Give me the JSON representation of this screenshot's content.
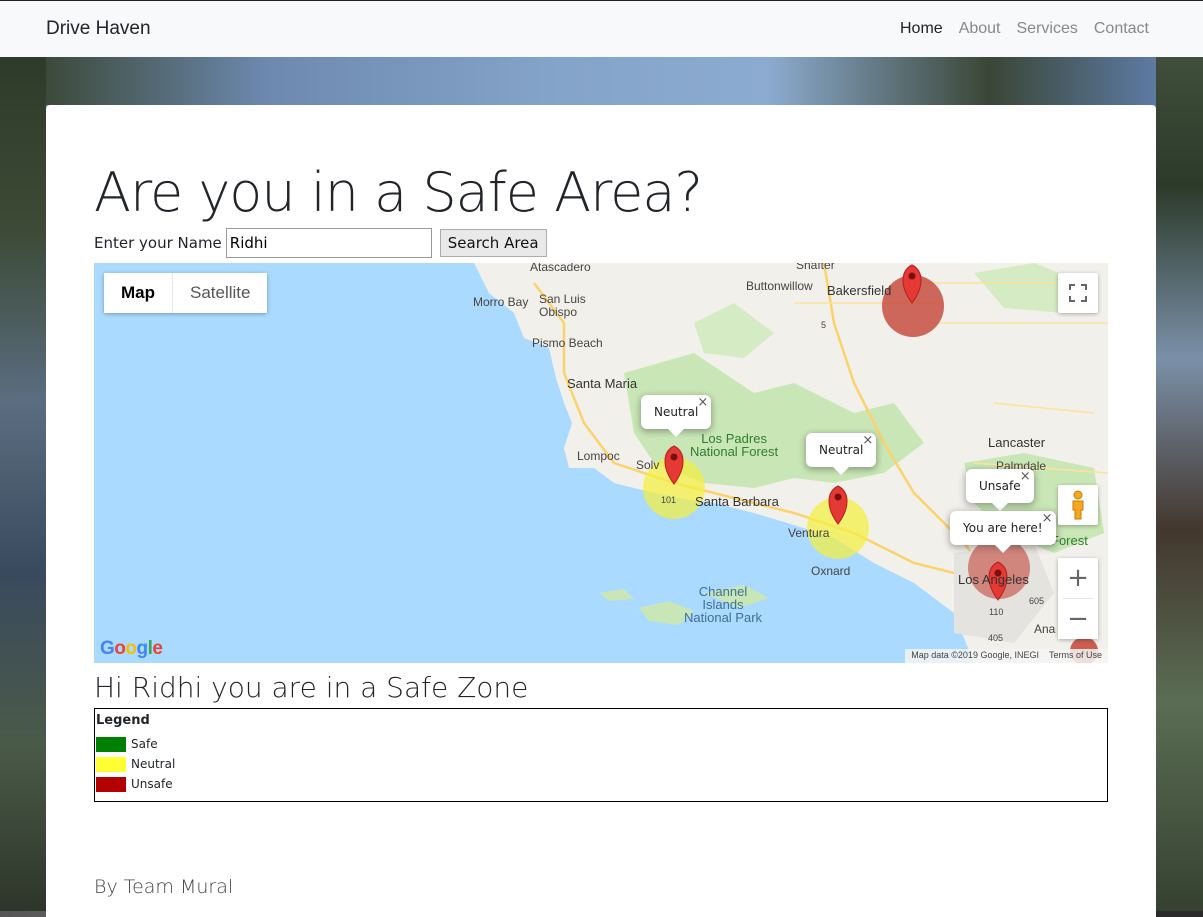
{
  "navbar": {
    "brand": "Drive Haven",
    "links": [
      "Home",
      "About",
      "Services",
      "Contact"
    ],
    "active": "Home"
  },
  "page": {
    "title": "Are you in a Safe Area?",
    "name_label": "Enter your Name",
    "name_value": "Ridhi",
    "search_button": "Search Area",
    "result_text": "Hi Ridhi you are in a Safe Zone",
    "footer": "By Team Mural"
  },
  "map": {
    "type_buttons": [
      "Map",
      "Satellite"
    ],
    "active_type": "Map",
    "places": {
      "atascadero": "Atascadero",
      "shafter": "Shafter",
      "buttonwillow": "Buttonwillow",
      "bakersfield": "Bakersfield",
      "morro_bay": "Morro Bay",
      "san_luis_obispo": "San Luis\nObispo",
      "pismo_beach": "Pismo Beach",
      "santa_maria": "Santa Maria",
      "lompoc": "Lompoc",
      "solvang": "Solv",
      "los_padres": "Los Padres\nNational Forest",
      "santa_barbara": "Santa Barbara",
      "ventura": "Ventura",
      "oxnard": "Oxnard",
      "lancaster": "Lancaster",
      "palmdale": "Palmdale",
      "los_angeles": "Los Angeles",
      "forest": "Forest",
      "channel_islands": "Channel\nIslands\nNational Park",
      "anaheim": "Ana",
      "route_101": "101",
      "route_5": "5",
      "route_110": "110",
      "route_405": "405",
      "route_605": "605"
    },
    "info_windows": {
      "neutral1": "Neutral",
      "neutral2": "Neutral",
      "unsafe": "Unsafe",
      "you_are_here": "You are here!"
    },
    "close_glyph": "×",
    "zoom_in": "+",
    "zoom_out": "−",
    "logo": "Google",
    "attribution": "Map data ©2019 Google, INEGI",
    "terms": "Terms of Use",
    "colors": {
      "water": "#aadaff",
      "land": "#f2f0ea",
      "park": "#c9e7b6",
      "unsafe_circle": "#c0392b",
      "neutral_circle": "#f4ef3c",
      "pin": "#e53935"
    }
  },
  "legend": {
    "title": "Legend",
    "items": [
      {
        "label": "Safe",
        "color": "#008000"
      },
      {
        "label": "Neutral",
        "color": "#ffff33"
      },
      {
        "label": "Unsafe",
        "color": "#b30000"
      }
    ]
  }
}
